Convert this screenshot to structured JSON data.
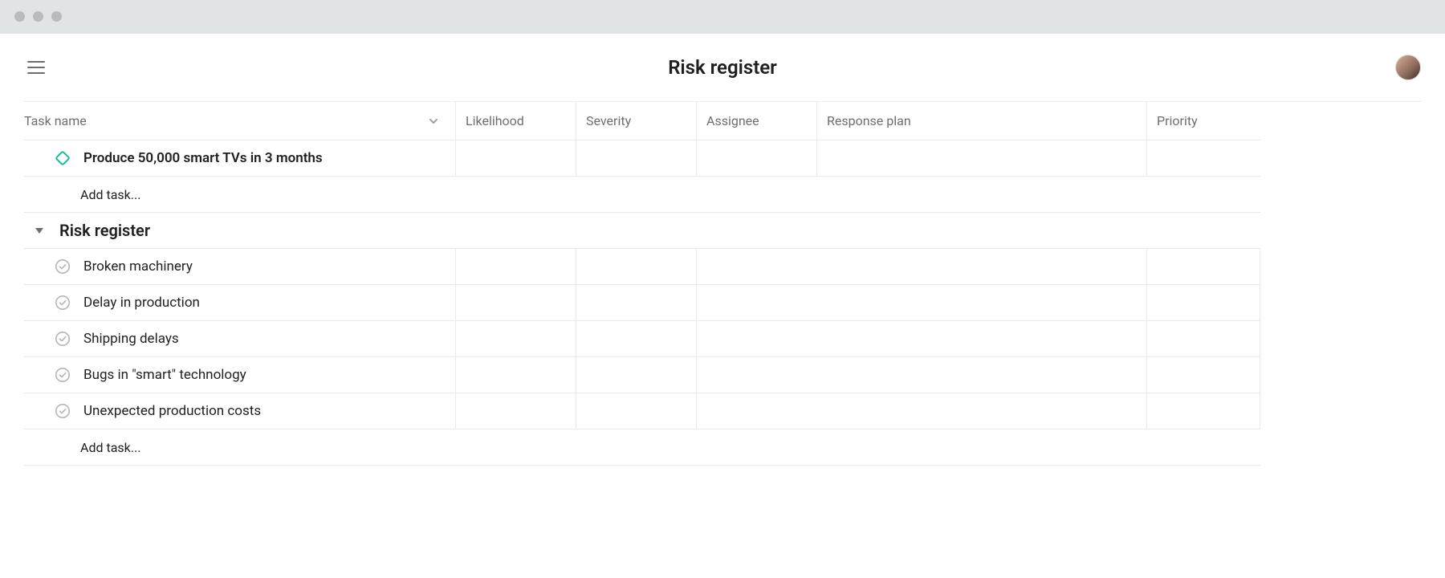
{
  "titlebar": {
    "dots": 3
  },
  "header": {
    "title": "Risk register"
  },
  "columns": {
    "task_name": "Task name",
    "likelihood": "Likelihood",
    "severity": "Severity",
    "assignee": "Assignee",
    "response_plan": "Response plan",
    "priority": "Priority"
  },
  "milestone": {
    "name": "Produce 50,000 smart TVs in 3 months"
  },
  "add_task_label": "Add task...",
  "section": {
    "title": "Risk register",
    "tasks": [
      {
        "name": "Broken machinery"
      },
      {
        "name": "Delay in production"
      },
      {
        "name": "Shipping delays"
      },
      {
        "name": "Bugs in \"smart\" technology"
      },
      {
        "name": "Unexpected production costs"
      }
    ]
  }
}
